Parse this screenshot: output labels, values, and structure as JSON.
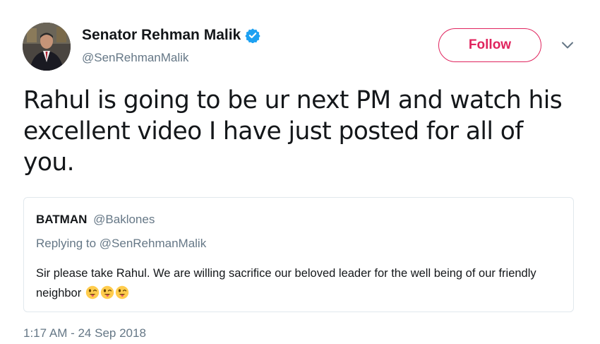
{
  "author": {
    "display_name": "Senator Rehman Malik",
    "handle": "@SenRehmanMalik",
    "verified": true
  },
  "actions": {
    "follow_label": "Follow",
    "menu_icon": "chevron-down-icon"
  },
  "tweet": {
    "text": "Rahul is going to be ur next PM and watch his excellent video I have just posted for all of you.",
    "timestamp": "1:17 AM - 24 Sep 2018"
  },
  "quoted_tweet": {
    "display_name": "BATMAN",
    "handle": "@Baklones",
    "replying_to": "Replying to @SenRehmanMalik",
    "text": "Sir please take Rahul. We are willing sacrifice our beloved leader for the well  being of our friendly neighbor",
    "emojis": [
      "winking-face-with-tongue-icon",
      "winking-face-with-tongue-icon",
      "winking-face-with-tongue-icon"
    ]
  },
  "colors": {
    "follow_accent": "#e0245e",
    "verified_blue": "#1da1f2",
    "secondary_text": "#657786",
    "border": "#e1e8ed"
  }
}
